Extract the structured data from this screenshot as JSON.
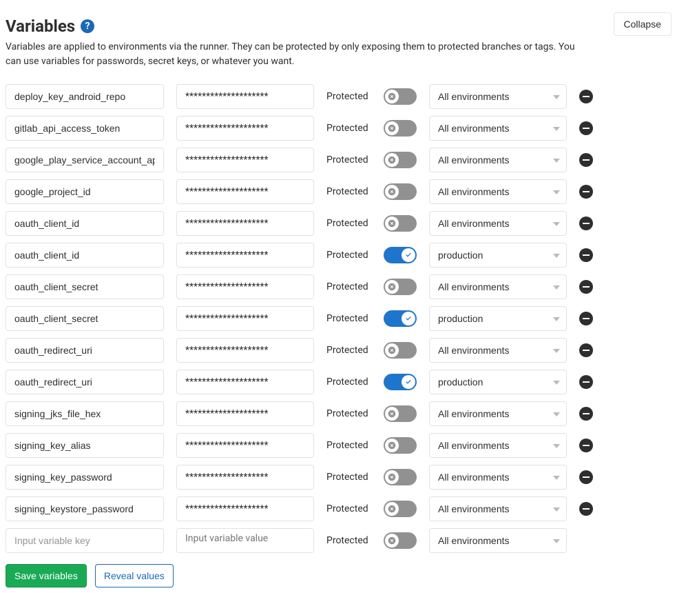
{
  "header": {
    "title": "Variables",
    "description": "Variables are applied to environments via the runner. They can be protected by only exposing them to protected branches or tags. You can use variables for passwords, secret keys, or whatever you want.",
    "collapse_label": "Collapse"
  },
  "labels": {
    "protected": "Protected",
    "key_placeholder": "Input variable key",
    "value_placeholder": "Input variable value"
  },
  "variables": [
    {
      "key": "deploy_key_android_repo",
      "value": "********************",
      "protected": false,
      "env": "All environments"
    },
    {
      "key": "gitlab_api_access_token",
      "value": "********************",
      "protected": false,
      "env": "All environments"
    },
    {
      "key": "google_play_service_account_api_",
      "value": "********************",
      "protected": false,
      "env": "All environments"
    },
    {
      "key": "google_project_id",
      "value": "********************",
      "protected": false,
      "env": "All environments"
    },
    {
      "key": "oauth_client_id",
      "value": "********************",
      "protected": false,
      "env": "All environments"
    },
    {
      "key": "oauth_client_id",
      "value": "********************",
      "protected": true,
      "env": "production"
    },
    {
      "key": "oauth_client_secret",
      "value": "********************",
      "protected": false,
      "env": "All environments"
    },
    {
      "key": "oauth_client_secret",
      "value": "********************",
      "protected": true,
      "env": "production"
    },
    {
      "key": "oauth_redirect_uri",
      "value": "********************",
      "protected": false,
      "env": "All environments"
    },
    {
      "key": "oauth_redirect_uri",
      "value": "********************",
      "protected": true,
      "env": "production"
    },
    {
      "key": "signing_jks_file_hex",
      "value": "********************",
      "protected": false,
      "env": "All environments"
    },
    {
      "key": "signing_key_alias",
      "value": "********************",
      "protected": false,
      "env": "All environments"
    },
    {
      "key": "signing_key_password",
      "value": "********************",
      "protected": false,
      "env": "All environments"
    },
    {
      "key": "signing_keystore_password",
      "value": "********************",
      "protected": false,
      "env": "All environments"
    }
  ],
  "new_row": {
    "key": "",
    "value": "",
    "protected": false,
    "env": "All environments"
  },
  "actions": {
    "save_label": "Save variables",
    "reveal_label": "Reveal values"
  }
}
